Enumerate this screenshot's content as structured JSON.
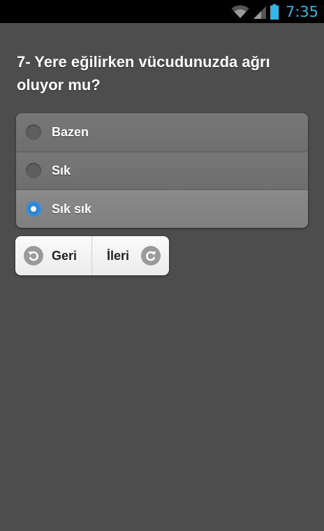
{
  "status_bar": {
    "time": "7:35",
    "icons": [
      "wifi-icon",
      "signal-icon",
      "battery-icon"
    ],
    "accent_color": "#33b5e5"
  },
  "question": {
    "text": "7- Yere eğilirken vücudunuzda ağrı oluyor mu?"
  },
  "options": [
    {
      "label": "Bazen",
      "selected": false
    },
    {
      "label": "Sık",
      "selected": false
    },
    {
      "label": "Sık sık",
      "selected": true
    }
  ],
  "nav": {
    "back_label": "Geri",
    "back_icon": "undo-arrow-icon",
    "next_label": "İleri",
    "next_icon": "redo-arrow-icon"
  },
  "colors": {
    "background": "#4d4d4d",
    "selected_radio": "#2f86d4"
  }
}
